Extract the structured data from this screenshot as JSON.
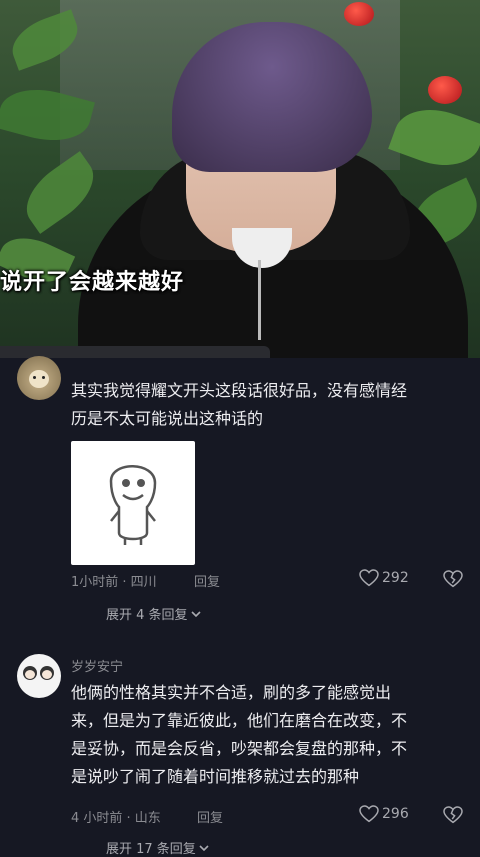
{
  "video": {
    "caption": "说开了会越来越好"
  },
  "comments": [
    {
      "username": "",
      "text_line1": "其实我觉得耀文开头这段话很好品，没有感情经",
      "text_line2": "历是不太可能说出这种话的",
      "sticker": "smiling-doodle-sticker",
      "time_location": "1小时前 · 四川",
      "reply_label": "回复",
      "likes": "292",
      "expand_label": "展开 4 条回复"
    },
    {
      "username": "岁岁安宁",
      "text_lines": [
        "他俩的性格其实并不合适，刷的多了能感觉出",
        "来，但是为了靠近彼此，他们在磨合在改变，不",
        "是妥协，而是会反省，吵架都会复盘的那种，不",
        "是说吵了闹了随着时间推移就过去的那种"
      ],
      "time_location": "4 小时前 · 山东",
      "reply_label": "回复",
      "likes": "296",
      "expand_label": "展开 17 条回复"
    }
  ],
  "colors": {
    "background": "#161823",
    "text": "#ededf0",
    "meta": "#8a8b91"
  },
  "icons": [
    "heart-icon",
    "broken-heart-icon",
    "chevron-down-icon"
  ]
}
